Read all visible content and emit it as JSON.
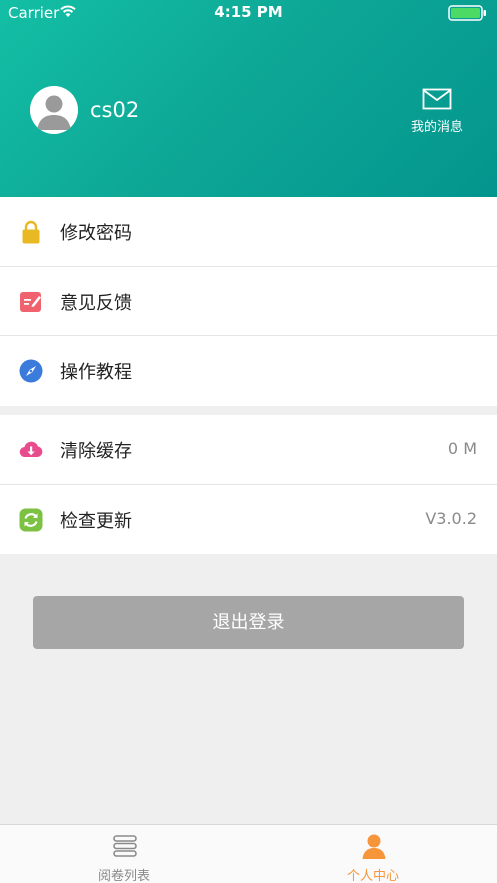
{
  "status_bar": {
    "carrier": "Carrier",
    "time": "4:15 PM",
    "icons": [
      "wifi-icon",
      "battery-icon"
    ]
  },
  "profile": {
    "username": "cs02",
    "messages_label": "我的消息",
    "header_gradient": [
      "#13bfa5",
      "#03958d"
    ]
  },
  "menu_section_1": [
    {
      "label": "修改密码",
      "icon": "lock-icon",
      "color": "#e8b923"
    },
    {
      "label": "意见反馈",
      "icon": "feedback-icon",
      "color": "#f0636e"
    },
    {
      "label": "操作教程",
      "icon": "compass-icon",
      "color": "#3a7bdc"
    }
  ],
  "menu_section_2": [
    {
      "label": "清除缓存",
      "icon": "cloud-download-icon",
      "color": "#e84c8e",
      "value": "0 M"
    },
    {
      "label": "检查更新",
      "icon": "refresh-icon",
      "color": "#7cc242",
      "value": "V3.0.2"
    }
  ],
  "logout_label": "退出登录",
  "tabbar": {
    "tabs": [
      {
        "label": "阅卷列表",
        "icon": "list-icon",
        "active": false
      },
      {
        "label": "个人中心",
        "icon": "person-icon",
        "active": true
      }
    ],
    "active_color": "#f7953a"
  }
}
